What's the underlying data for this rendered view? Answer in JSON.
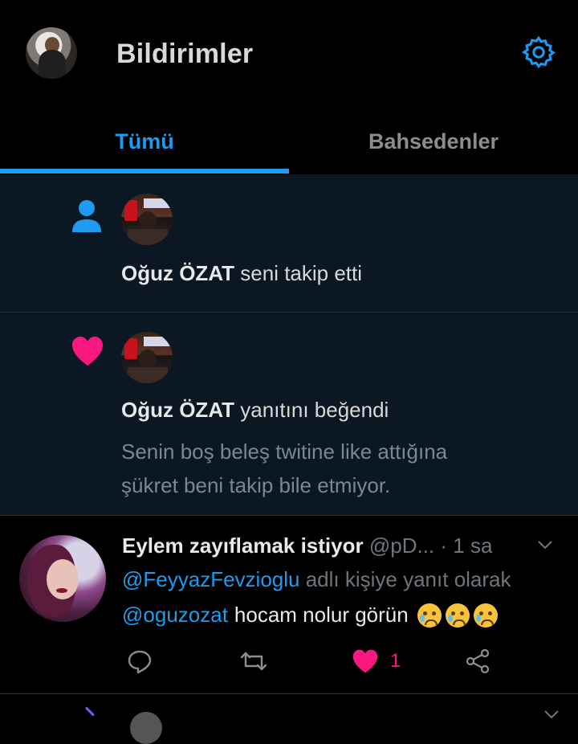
{
  "header": {
    "title": "Bildirimler",
    "settings_icon": "gear-icon"
  },
  "tabs": [
    {
      "label": "Tümü",
      "active": true
    },
    {
      "label": "Bahsedenler",
      "active": false
    }
  ],
  "notifications": [
    {
      "icon": "person-icon",
      "user": "Oğuz ÖZAT",
      "action": "seni takip etti"
    },
    {
      "icon": "heart-icon",
      "user": "Oğuz ÖZAT",
      "action": "yanıtını beğendi",
      "line1": "Senin boş beleş twitine like attığına",
      "line2": "şükret beni takip bile etmiyor."
    }
  ],
  "tweet": {
    "name": "Eylem zayıflamak istiyor",
    "handle": "@pD...",
    "time": "· 1 sa",
    "reply_to": "@FeyyazFevzioglu",
    "reply_suffix": "adlı kişiye yanıt olarak",
    "mention": "@oguzozat",
    "text": "hocam nolur görün",
    "emojis": [
      "crying-face",
      "crying-face",
      "crying-face"
    ],
    "like_count": "1"
  },
  "colors": {
    "accent": "#1d9bf0",
    "like": "#f91880",
    "background": "#000000",
    "notif_bg": "#0b1722"
  }
}
